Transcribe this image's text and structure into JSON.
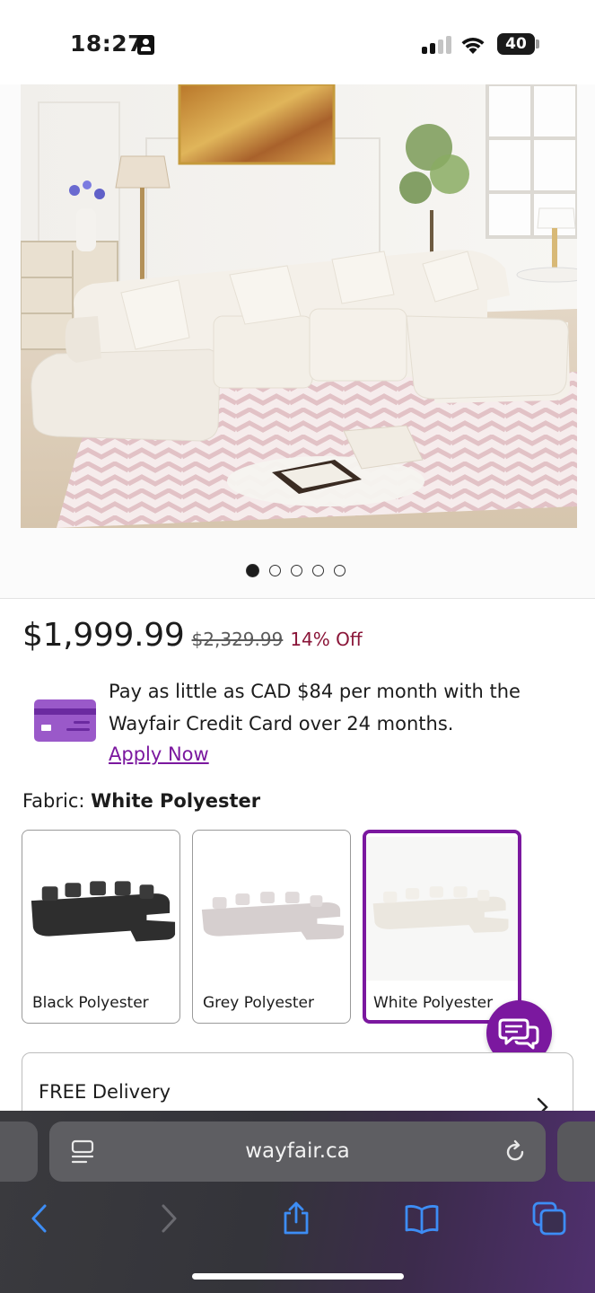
{
  "status_bar": {
    "time": "18:27",
    "battery": "40"
  },
  "product": {
    "carousel_total": 5,
    "carousel_active": 1,
    "price": "$1,999.99",
    "original_price": "$2,329.99",
    "discount": "14% Off"
  },
  "credit": {
    "text": "Pay as little as CAD $84 per month with the Wayfair Credit Card over 24 months.",
    "link": "Apply Now"
  },
  "fabric": {
    "label": "Fabric:",
    "selected": "White Polyester",
    "options": [
      {
        "label": "Black Polyester",
        "color": "#2b2b2b"
      },
      {
        "label": "Grey Polyester",
        "color": "#d8d2d2"
      },
      {
        "label": "White Polyester",
        "color": "#ece8e0"
      }
    ]
  },
  "delivery": {
    "label": "FREE Delivery"
  },
  "browser": {
    "url": "wayfair.ca"
  },
  "colors": {
    "brand_purple": "#7b189f",
    "discount_red": "#8a1538"
  }
}
